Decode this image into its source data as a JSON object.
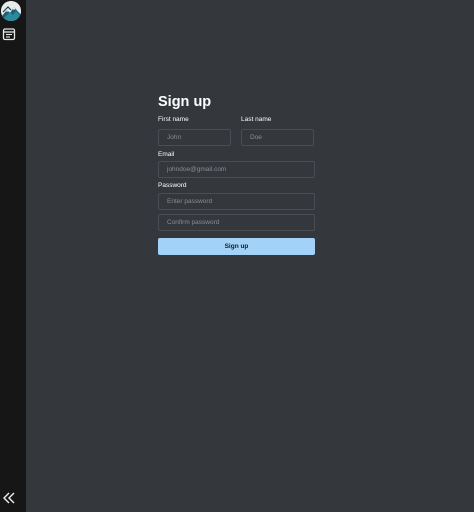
{
  "sidebar": {
    "logo_icon": "mountain-logo-icon",
    "nav_icon": "calendar-icon",
    "collapse_icon": "double-chevron-left-icon"
  },
  "form": {
    "title": "Sign up",
    "first_name": {
      "label": "First name",
      "placeholder": "John"
    },
    "last_name": {
      "label": "Last name",
      "placeholder": "Doe"
    },
    "email": {
      "label": "Email",
      "placeholder": "johndoe@gmail.com"
    },
    "password": {
      "label": "Password",
      "placeholder": "Enter password",
      "confirm_placeholder": "Confirm password"
    },
    "submit_label": "Sign up"
  },
  "colors": {
    "background": "#34373c",
    "sidebar": "#161617",
    "button": "#a3d2f8",
    "input_border": "#4a4e54"
  }
}
